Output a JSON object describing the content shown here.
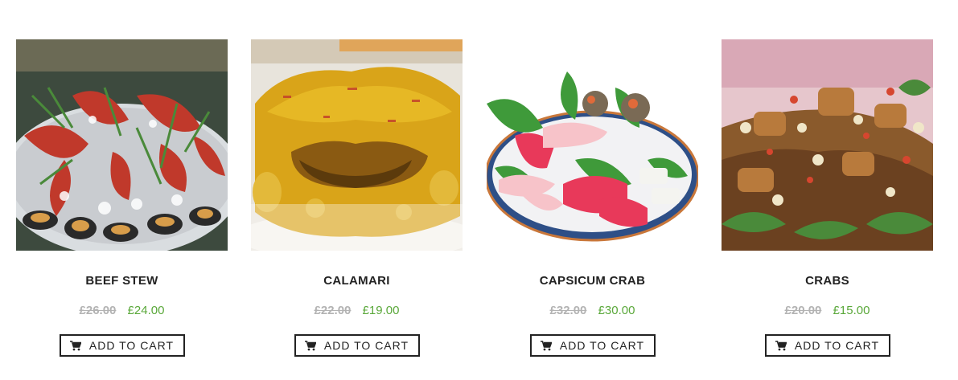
{
  "products": [
    {
      "name": "BEEF STEW",
      "old_price": "£26.00",
      "price": "£24.00",
      "button": "ADD TO CART"
    },
    {
      "name": "CALAMARI",
      "old_price": "£22.00",
      "price": "£19.00",
      "button": "ADD TO CART"
    },
    {
      "name": "CAPSICUM CRAB",
      "old_price": "£32.00",
      "price": "£30.00",
      "button": "ADD TO CART"
    },
    {
      "name": "CRABS",
      "old_price": "£20.00",
      "price": "£15.00",
      "button": "ADD TO CART"
    }
  ],
  "colors": {
    "price_new": "#5aa83a",
    "price_old": "#b3b3b3",
    "text": "#222222"
  },
  "icons": {
    "button_icon": "cart-icon"
  }
}
